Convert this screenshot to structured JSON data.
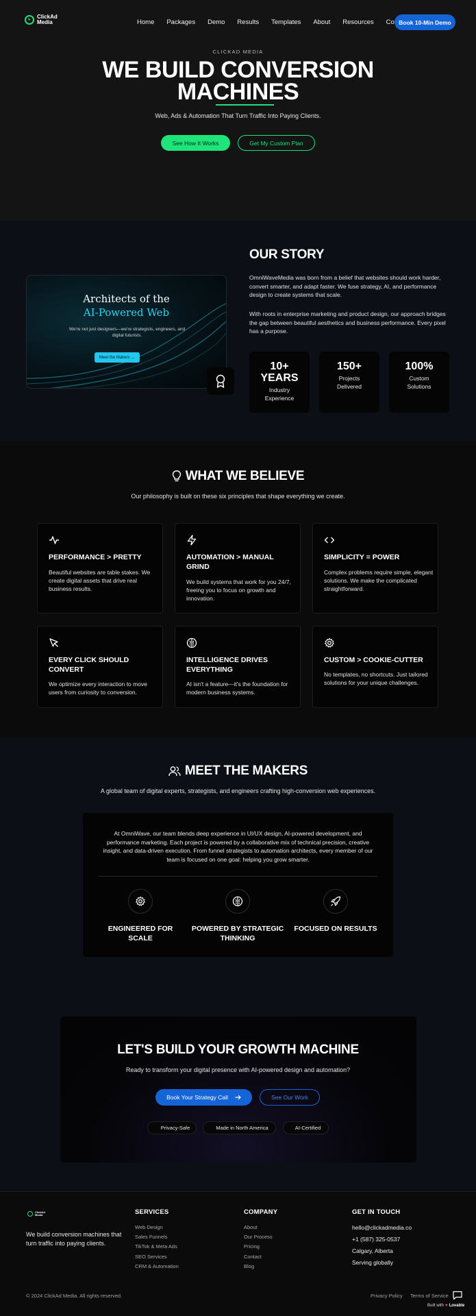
{
  "brand": {
    "name": "ClickAd Media",
    "accent": "#1ee57a",
    "blue": "#1565d8",
    "cyan": "#2fd4f0"
  },
  "nav": {
    "links": [
      "Home",
      "Packages",
      "Demo",
      "Results",
      "Templates",
      "About",
      "Resources",
      "Contact"
    ],
    "cta": "Book 10-Min Demo"
  },
  "hero": {
    "kicker": "CLICKAD MEDIA",
    "title_line1": "WE BUILD CONVERSION",
    "title_line2": "MACHINES",
    "subtitle": "Web, Ads & Automation That Turn Traffic Into Paying Clients.",
    "primary_cta": "See How It Works",
    "secondary_cta": "Get My Custom Plan"
  },
  "story": {
    "card_title1": "Architects of the",
    "card_title2": "AI-Powered Web",
    "card_body": "We're not just designers—we're strategists, engineers, and digital futurists.",
    "card_button": "Meet the Makers →",
    "title": "OUR STORY",
    "p1": "OmniWaveMedia was born from a belief that websites should work harder, convert smarter, and adapt faster. We fuse strategy, AI, and performance design to create systems that scale.",
    "p2": "With roots in enterprise marketing and product design, our approach bridges the gap between beautiful aesthetics and business performance. Every pixel has a purpose.",
    "stats": [
      {
        "num": "10+",
        "num2": "YEARS",
        "label": "Industry Experience"
      },
      {
        "num": "150+",
        "label": "Projects Delivered"
      },
      {
        "num": "100%",
        "label": "Custom Solutions"
      }
    ]
  },
  "believe": {
    "title": "WHAT WE BELIEVE",
    "subtitle": "Our philosophy is built on these six principles that shape everything we create.",
    "cards": [
      {
        "icon": "activity-icon",
        "title": "PERFORMANCE > PRETTY",
        "body": "Beautiful websites are table stakes. We create digital assets that drive real business results."
      },
      {
        "icon": "lightning-icon",
        "title": "AUTOMATION > MANUAL GRIND",
        "body": "We build systems that work for you 24/7, freeing you to focus on growth and innovation."
      },
      {
        "icon": "code-icon",
        "title": "SIMPLICITY = POWER",
        "body": "Complex problems require simple, elegant solutions. We make the complicated straightforward."
      },
      {
        "icon": "cursor-icon",
        "title": "EVERY CLICK SHOULD CONVERT",
        "body": "We optimize every interaction to move users from curiosity to conversion."
      },
      {
        "icon": "brain-icon",
        "title": "INTELLIGENCE DRIVES EVERYTHING",
        "body": "AI isn't a feature—it's the foundation for modern business systems."
      },
      {
        "icon": "gear-icon",
        "title": "CUSTOM > COOKIE-CUTTER",
        "body": "No templates, no shortcuts. Just tailored solutions for your unique challenges."
      }
    ]
  },
  "makers": {
    "title": "MEET THE MAKERS",
    "subtitle": "A global team of digital experts, strategists, and engineers crafting high-conversion web experiences.",
    "body": "At OmniWave, our team blends deep experience in UI/UX design, AI-powered development, and performance marketing. Each project is powered by a collaborative mix of technical precision, creative insight, and data-driven execution. From funnel strategists to automation architects, every member of our team is focused on one goal: helping you grow smarter.",
    "pillars": [
      {
        "icon": "gear-icon",
        "title": "ENGINEERED FOR SCALE"
      },
      {
        "icon": "brain-icon",
        "title": "POWERED BY STRATEGIC THINKING"
      },
      {
        "icon": "rocket-icon",
        "title": "FOCUSED ON RESULTS"
      }
    ]
  },
  "cta": {
    "title": "LET'S BUILD YOUR GROWTH MACHINE",
    "subtitle": "Ready to transform your digital presence with AI-powered design and automation?",
    "primary": "Book Your Strategy Call",
    "secondary": "See Our Work",
    "badges": [
      "Privacy-Safe",
      "Made in North America",
      "AI-Certified"
    ]
  },
  "footer": {
    "tagline": "We build conversion machines that turn traffic into paying clients.",
    "services_title": "SERVICES",
    "services": [
      "Web Design",
      "Sales Funnels",
      "TikTok & Meta Ads",
      "SEO Services",
      "CRM & Automation"
    ],
    "company_title": "COMPANY",
    "company": [
      "About",
      "Our Process",
      "Pricing",
      "Contact",
      "Blog"
    ],
    "contact_title": "GET IN TOUCH",
    "contact": [
      "hello@clickadmedia.co",
      "+1 (587) 325-0537",
      "Calgary, Alberta",
      "Serving globally"
    ],
    "copyright": "© 2024 ClickAd Media. All rights reserved.",
    "privacy": "Privacy Policy",
    "terms": "Terms of Service",
    "built_with": "Built with",
    "lovable": "Lovable"
  }
}
